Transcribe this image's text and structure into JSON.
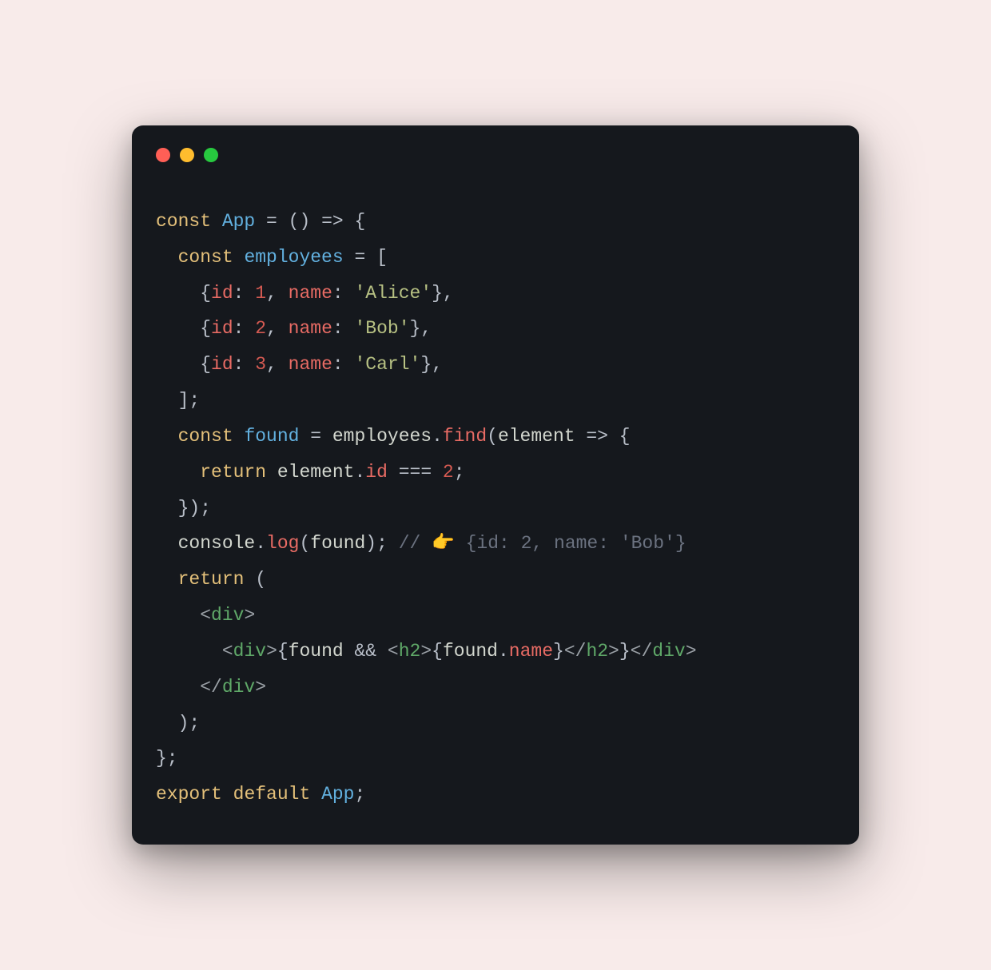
{
  "window": {
    "lights": [
      "red",
      "yellow",
      "green"
    ]
  },
  "code": {
    "l1": {
      "const": "const",
      "app": "App",
      "rest": " = () => {"
    },
    "l2": {
      "const": "const",
      "emp": "employees",
      "rest": " = ["
    },
    "l3": {
      "open": "{",
      "id": "id",
      "colon1": ": ",
      "n": "1",
      "comma1": ", ",
      "name": "name",
      "colon2": ": ",
      "str": "'Alice'",
      "close": "},"
    },
    "l4": {
      "open": "{",
      "id": "id",
      "colon1": ": ",
      "n": "2",
      "comma1": ", ",
      "name": "name",
      "colon2": ": ",
      "str": "'Bob'",
      "close": "},"
    },
    "l5": {
      "open": "{",
      "id": "id",
      "colon1": ": ",
      "n": "3",
      "comma1": ", ",
      "name": "name",
      "colon2": ": ",
      "str": "'Carl'",
      "close": "},"
    },
    "l6": {
      "txt": "];"
    },
    "l7": {
      "const": "const",
      "found": "found",
      "eq": " = ",
      "emp": "employees",
      "dot": ".",
      "find": "find",
      "open": "(",
      "elem": "element",
      "arrow": " => {"
    },
    "l8": {
      "ret": "return",
      "sp": " ",
      "elem": "element",
      "dot": ".",
      "id": "id",
      "eq": " === ",
      "n": "2",
      "semi": ";"
    },
    "l9": {
      "txt": "});"
    },
    "l10": {
      "console": "console",
      "dot": ".",
      "log": "log",
      "open": "(",
      "found": "found",
      "close": ");",
      "sp": " ",
      "slashes": "//",
      "sp2": " ",
      "emoji": "👉",
      "sp3": " ",
      "rest": "{id: 2, name: 'Bob'}"
    },
    "l11": {
      "ret": "return",
      "rest": " ("
    },
    "l12": {
      "lt": "<",
      "tag": "div",
      "gt": ">"
    },
    "l13": {
      "lt1": "<",
      "div1": "div",
      "gt1": ">",
      "ob1": "{",
      "found": "found",
      "and": " && ",
      "lt2": "<",
      "h2a": "h2",
      "gt2": ">",
      "ob2": "{",
      "found2": "found",
      "dot": ".",
      "name": "name",
      "cb2": "}",
      "lt3": "</",
      "h2b": "h2",
      "gt3": ">",
      "cb1": "}",
      "lt4": "</",
      "div2": "div",
      "gt4": ">"
    },
    "l14": {
      "lt": "</",
      "tag": "div",
      "gt": ">"
    },
    "l15": {
      "txt": ");"
    },
    "l16": {
      "txt": "};"
    },
    "l17": {
      "export": "export",
      "sp1": " ",
      "default": "default",
      "sp2": " ",
      "app": "App",
      "semi": ";"
    }
  }
}
